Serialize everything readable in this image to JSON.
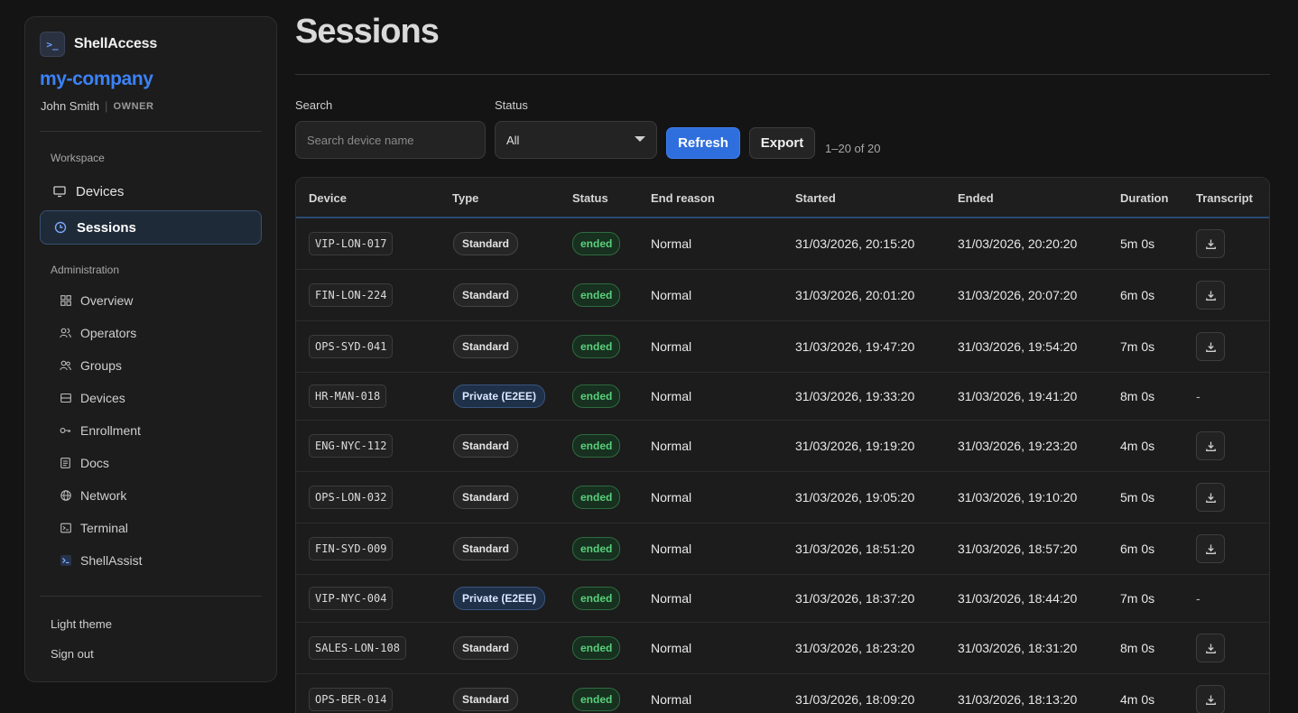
{
  "brand": {
    "logo_text": ">_",
    "name": "ShellAccess"
  },
  "org": {
    "name": "my-company",
    "user": "John Smith",
    "separator": "|",
    "role": "OWNER"
  },
  "sidebar": {
    "workspace_label": "Workspace",
    "workspace_items": [
      {
        "label": "Devices",
        "icon": "monitor-icon"
      },
      {
        "label": "Sessions",
        "icon": "clock-icon",
        "active": true
      }
    ],
    "admin_label": "Administration",
    "admin_items": [
      {
        "label": "Overview",
        "icon": "grid-icon"
      },
      {
        "label": "Operators",
        "icon": "users-icon"
      },
      {
        "label": "Groups",
        "icon": "group-icon"
      },
      {
        "label": "Devices",
        "icon": "server-icon"
      },
      {
        "label": "Enrollment",
        "icon": "key-icon"
      },
      {
        "label": "Docs",
        "icon": "document-icon"
      },
      {
        "label": "Network",
        "icon": "globe-icon"
      },
      {
        "label": "Terminal",
        "icon": "terminal-icon"
      },
      {
        "label": "ShellAssist",
        "icon": "shellassist-icon"
      }
    ],
    "footer": {
      "theme_toggle": "Light theme",
      "sign_out": "Sign out"
    }
  },
  "page": {
    "title": "Sessions"
  },
  "filters": {
    "search_label": "Search",
    "search_placeholder": "Search device name",
    "search_value": "",
    "status_label": "Status",
    "status_value": "All",
    "refresh_label": "Refresh",
    "export_label": "Export",
    "range_text": "1–20 of 20"
  },
  "table": {
    "columns": [
      "Device",
      "Type",
      "Status",
      "End reason",
      "Started",
      "Ended",
      "Duration",
      "Transcript"
    ],
    "rows": [
      {
        "device": "VIP-LON-017",
        "type": "Standard",
        "status": "ended",
        "end_reason": "Normal",
        "started": "31/03/2026, 20:15:20",
        "ended": "31/03/2026, 20:20:20",
        "duration": "5m 0s",
        "transcript": "download"
      },
      {
        "device": "FIN-LON-224",
        "type": "Standard",
        "status": "ended",
        "end_reason": "Normal",
        "started": "31/03/2026, 20:01:20",
        "ended": "31/03/2026, 20:07:20",
        "duration": "6m 0s",
        "transcript": "download"
      },
      {
        "device": "OPS-SYD-041",
        "type": "Standard",
        "status": "ended",
        "end_reason": "Normal",
        "started": "31/03/2026, 19:47:20",
        "ended": "31/03/2026, 19:54:20",
        "duration": "7m 0s",
        "transcript": "download"
      },
      {
        "device": "HR-MAN-018",
        "type": "Private (E2EE)",
        "status": "ended",
        "end_reason": "Normal",
        "started": "31/03/2026, 19:33:20",
        "ended": "31/03/2026, 19:41:20",
        "duration": "8m 0s",
        "transcript": "-"
      },
      {
        "device": "ENG-NYC-112",
        "type": "Standard",
        "status": "ended",
        "end_reason": "Normal",
        "started": "31/03/2026, 19:19:20",
        "ended": "31/03/2026, 19:23:20",
        "duration": "4m 0s",
        "transcript": "download"
      },
      {
        "device": "OPS-LON-032",
        "type": "Standard",
        "status": "ended",
        "end_reason": "Normal",
        "started": "31/03/2026, 19:05:20",
        "ended": "31/03/2026, 19:10:20",
        "duration": "5m 0s",
        "transcript": "download"
      },
      {
        "device": "FIN-SYD-009",
        "type": "Standard",
        "status": "ended",
        "end_reason": "Normal",
        "started": "31/03/2026, 18:51:20",
        "ended": "31/03/2026, 18:57:20",
        "duration": "6m 0s",
        "transcript": "download"
      },
      {
        "device": "VIP-NYC-004",
        "type": "Private (E2EE)",
        "status": "ended",
        "end_reason": "Normal",
        "started": "31/03/2026, 18:37:20",
        "ended": "31/03/2026, 18:44:20",
        "duration": "7m 0s",
        "transcript": "-"
      },
      {
        "device": "SALES-LON-108",
        "type": "Standard",
        "status": "ended",
        "end_reason": "Normal",
        "started": "31/03/2026, 18:23:20",
        "ended": "31/03/2026, 18:31:20",
        "duration": "8m 0s",
        "transcript": "download"
      },
      {
        "device": "OPS-BER-014",
        "type": "Standard",
        "status": "ended",
        "end_reason": "Normal",
        "started": "31/03/2026, 18:09:20",
        "ended": "31/03/2026, 18:13:20",
        "duration": "4m 0s",
        "transcript": "download"
      }
    ]
  },
  "colors": {
    "accent": "#3b82f6",
    "ended_status": "#5ad07c",
    "background": "#141414"
  }
}
